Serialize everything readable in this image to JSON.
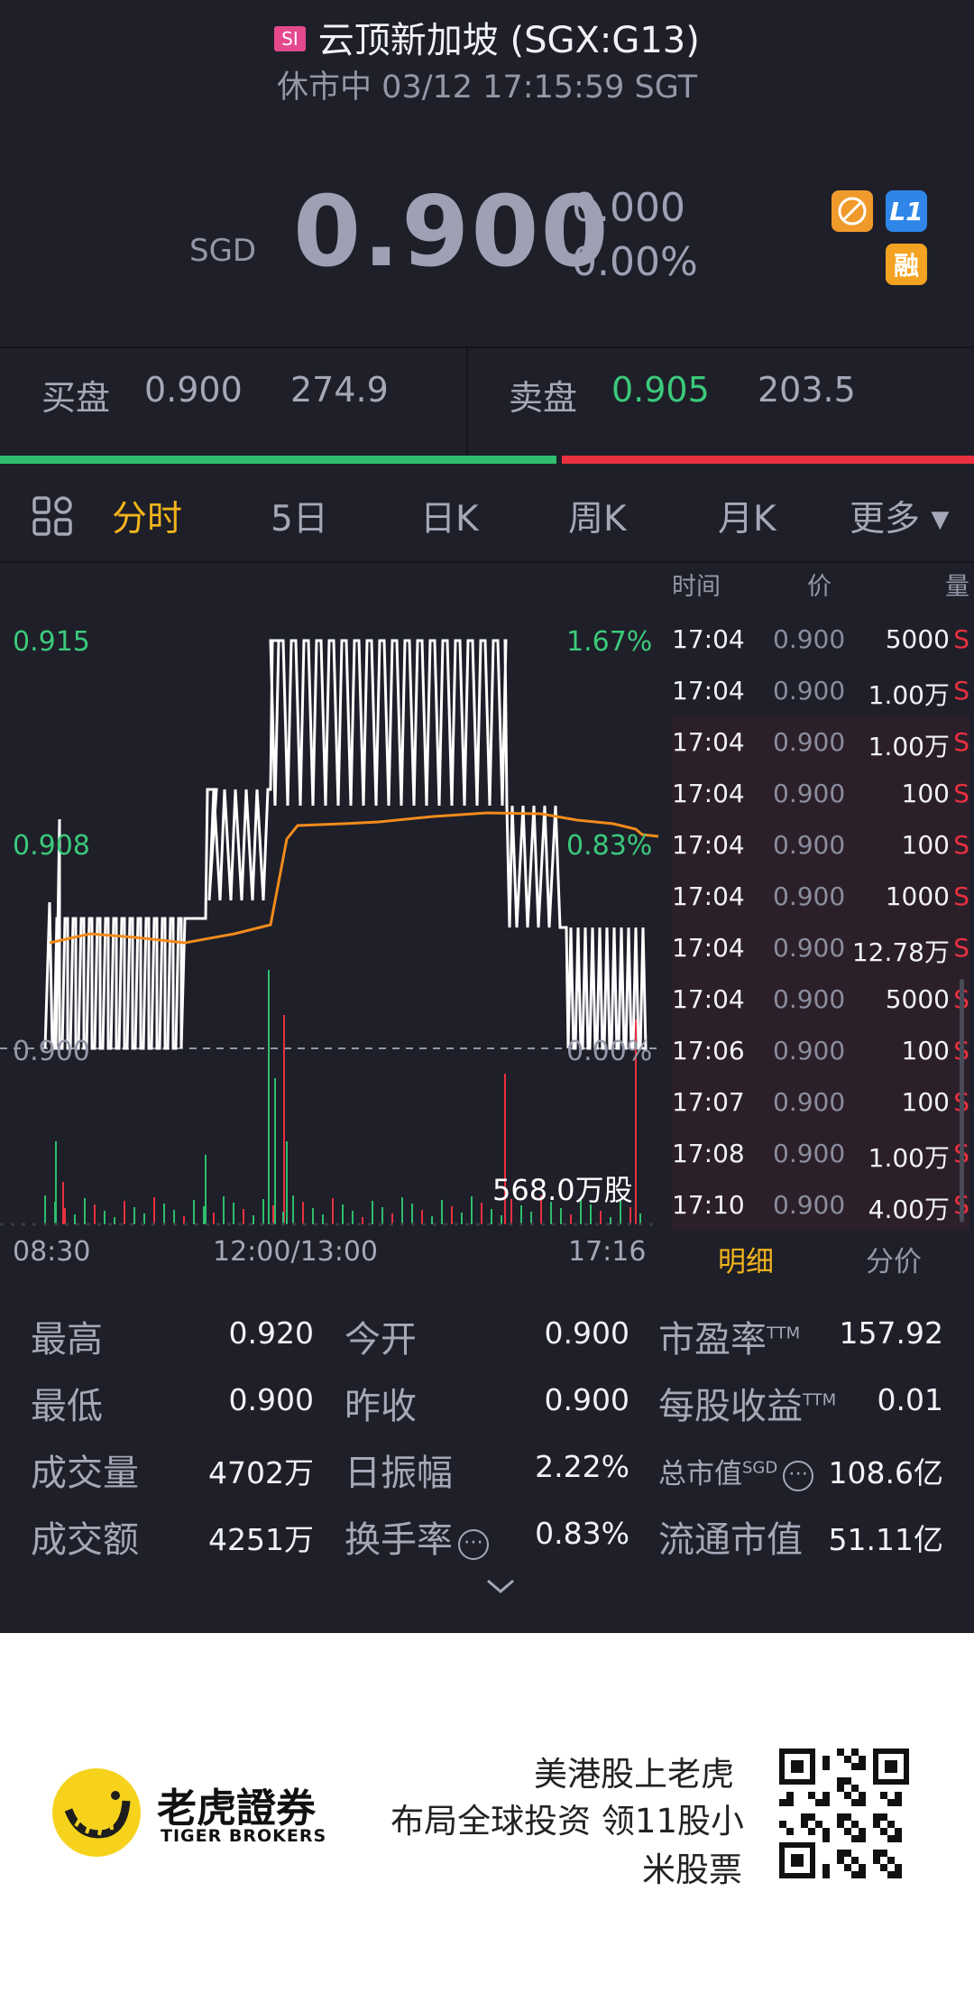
{
  "header": {
    "market_badge": "SI",
    "title": "云顶新加坡 (SGX:G13)",
    "status": "休市中 03/12 17:15:59 SGT"
  },
  "quote": {
    "currency": "SGD",
    "price": "0.900",
    "change": "0.000",
    "change_pct": "0.00%",
    "badges": [
      {
        "icon": "no-short-icon",
        "color": "#f09a2c"
      },
      {
        "label": "L1",
        "color": "#2f86e8"
      },
      {
        "label": "融",
        "color": "#f3a321"
      }
    ]
  },
  "order_book": {
    "bid_label": "买盘",
    "bid_price": "0.900",
    "bid_size": "274.9",
    "ask_label": "卖盘",
    "ask_price": "0.905",
    "ask_size": "203.5",
    "bid_ratio": 0.574,
    "bid_color": "#2ebd6e",
    "ask_color": "#e9303f"
  },
  "tabs": {
    "items": [
      "分时",
      "5日",
      "日K",
      "周K",
      "月K"
    ],
    "more": "更多",
    "active_index": 0
  },
  "chart": {
    "y_labels": {
      "top": "0.915",
      "mid": "0.908",
      "base": "0.900"
    },
    "y_pct": {
      "top": "1.67%",
      "mid": "0.83%",
      "base": "0.00%"
    },
    "volume_label": "568.0万股",
    "x_labels": [
      "08:30",
      "12:00/13:00",
      "17:16"
    ]
  },
  "chart_data": {
    "type": "line",
    "y_axis": [
      "0.900",
      "0.908",
      "0.915"
    ],
    "y_pct_axis": [
      "0.00%",
      "0.83%",
      "1.67%"
    ],
    "x_labels": [
      "08:30",
      "12:00/13:00",
      "17:16"
    ],
    "series": [],
    "volume_max_label": "568.0万股"
  },
  "ticks": {
    "headers": [
      "时间",
      "价",
      "量"
    ],
    "rows": [
      {
        "time": "17:04",
        "price": "0.900",
        "vol": "5000",
        "side": "S"
      },
      {
        "time": "17:04",
        "price": "0.900",
        "vol": "1.00万",
        "side": "S"
      },
      {
        "time": "17:04",
        "price": "0.900",
        "vol": "1.00万",
        "side": "S"
      },
      {
        "time": "17:04",
        "price": "0.900",
        "vol": "100",
        "side": "S"
      },
      {
        "time": "17:04",
        "price": "0.900",
        "vol": "100",
        "side": "S"
      },
      {
        "time": "17:04",
        "price": "0.900",
        "vol": "1000",
        "side": "S"
      },
      {
        "time": "17:04",
        "price": "0.900",
        "vol": "12.78万",
        "side": "S"
      },
      {
        "time": "17:04",
        "price": "0.900",
        "vol": "5000",
        "side": "S"
      },
      {
        "time": "17:06",
        "price": "0.900",
        "vol": "100",
        "side": "S"
      },
      {
        "time": "17:07",
        "price": "0.900",
        "vol": "100",
        "side": "S"
      },
      {
        "time": "17:08",
        "price": "0.900",
        "vol": "1.00万",
        "side": "S"
      },
      {
        "time": "17:10",
        "price": "0.900",
        "vol": "4.00万",
        "side": "S"
      }
    ],
    "tab_detail": "明细",
    "tab_price": "分价"
  },
  "stats": [
    [
      {
        "label": "最高",
        "value": "0.920"
      },
      {
        "label": "今开",
        "value": "0.900"
      },
      {
        "label": "市盈率",
        "sup": "TTM",
        "value": "157.92"
      }
    ],
    [
      {
        "label": "最低",
        "value": "0.900"
      },
      {
        "label": "昨收",
        "value": "0.900"
      },
      {
        "label": "每股收益",
        "sup": "TTM",
        "value": "0.01"
      }
    ],
    [
      {
        "label": "成交量",
        "value": "4702万"
      },
      {
        "label": "日振幅",
        "value": "2.22%"
      },
      {
        "label": "总市值",
        "sup": "SGD",
        "value": "108.6亿"
      }
    ],
    [
      {
        "label": "成交额",
        "value": "4251万"
      },
      {
        "label": "换手率",
        "value": "0.83%"
      },
      {
        "label": "流通市值",
        "value": "51.11亿"
      }
    ]
  ],
  "promo": {
    "brand_cn": "老虎證券",
    "brand_en": "TIGER BROKERS",
    "line1": "美港股上老虎",
    "line2": "布局全球投资 领11股小",
    "line3": "米股票"
  }
}
